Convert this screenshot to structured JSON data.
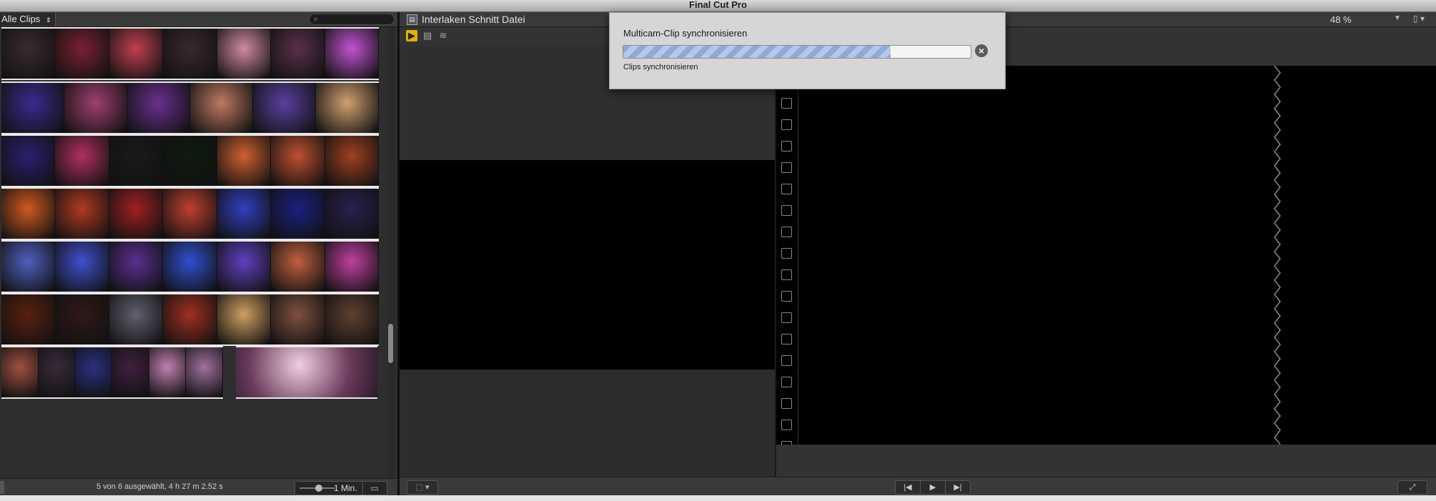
{
  "app": {
    "title": "Final Cut Pro"
  },
  "browser": {
    "clips_filter": "Alle Clips",
    "selection_info": "5 von 6 ausgewählt, 4 h 27 m 2.52 s",
    "zoom_label": "1 Min.",
    "strips": [
      [
        "#3a2a30",
        "#7a2030",
        "#c04050",
        "#3a2830",
        "#d08aa0",
        "#5a2f4a",
        "#c055d0"
      ],
      [
        "#3b2a90",
        "#a04070",
        "#6a3090",
        "#c07a60",
        "#5a40a0",
        "#d0a070"
      ],
      [
        "#2a2070",
        "#b03060",
        "#1a1a1a",
        "#0f1a10",
        "#d06030",
        "#c05030",
        "#a04020"
      ],
      [
        "#d05a20",
        "#b03a20",
        "#a02020",
        "#c04030",
        "#3040c0",
        "#1a2080",
        "#2a2050"
      ],
      [
        "#5060c0",
        "#4050d0",
        "#5a3090",
        "#3050d0",
        "#6040c0",
        "#c06040",
        "#c040a0"
      ],
      [
        "#5a2010",
        "#301818",
        "#606070",
        "#a03020",
        "#d0a060",
        "#805040",
        "#604030"
      ],
      [
        "#a05040",
        "#3a2a3a",
        "#2a3080",
        "#402040",
        "#c080b0",
        "#a070a0"
      ]
    ]
  },
  "viewer": {
    "project_title": "Interlaken Schnitt Datei",
    "zoom_percent": "48 %"
  },
  "dialog": {
    "title": "Multicam-Clip synchronisieren",
    "status": "Clips synchronisieren",
    "progress": 0.77
  }
}
